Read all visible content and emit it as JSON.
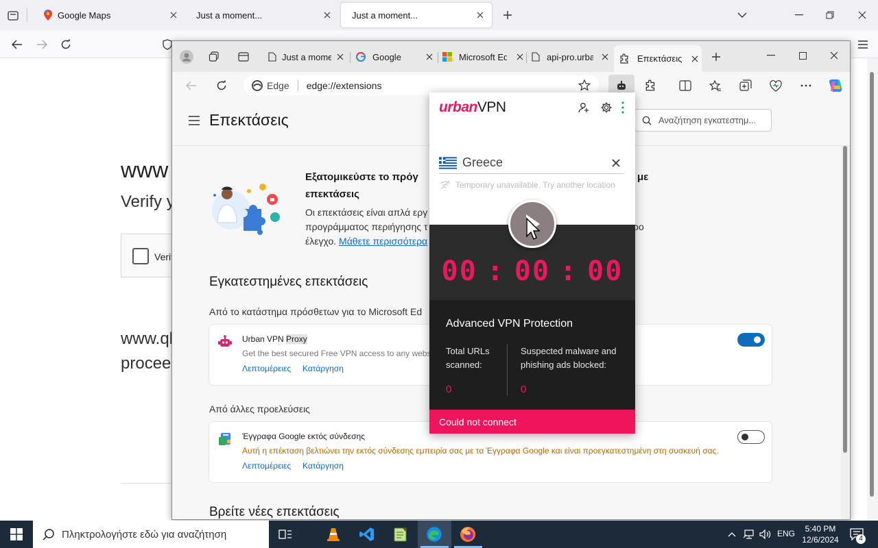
{
  "firefox": {
    "tabs": [
      {
        "label": "Google Maps"
      },
      {
        "label": "Just a moment..."
      },
      {
        "label": "Just a moment..."
      }
    ]
  },
  "page": {
    "heading_partial": "www",
    "verify_partial": "Verify y",
    "checkbox_label_partial": "Verif",
    "line1_partial": "www.ql",
    "line2_partial": "procee"
  },
  "edge": {
    "tabs": [
      {
        "label": "Just a mome"
      },
      {
        "label": "Google"
      },
      {
        "label": "Microsoft Ed"
      },
      {
        "label": "api-pro.urba"
      },
      {
        "label": "Επεκτάσεις"
      }
    ],
    "address": {
      "prefix": "Edge",
      "url": "edge://extensions"
    },
    "page_title": "Επεκτάσεις",
    "search_placeholder": "Αναζήτηση εγκατεστημ...",
    "promo": {
      "title_a": "Εξατομικεύστε το πρόγ",
      "title_b": "με",
      "title_c": "επεκτάσεις",
      "body_a": "Οι επεκτάσεις είναι απλά εργ",
      "body_b": "προγράμματος περιήγησης τ",
      "body_b2": "ρο",
      "body_c": "έλεγχο.",
      "learn_more": "Μάθετε περισσότερα"
    },
    "installed_heading": "Εγκατεστημένες επεκτάσεις",
    "store_label": "Από το κατάστημα πρόσθετων για το Microsoft Ed",
    "ext1": {
      "name": "Urban VPN",
      "name_highlight": "Proxy",
      "desc": "Get the best secured Free VPN access to any websit",
      "details": "Λεπτομέρειες",
      "remove": "Κατάργηση",
      "enabled": true
    },
    "other_label": "Από άλλες προελεύσεις",
    "ext2": {
      "name": "Έγγραφα Google εκτός σύνδεσης",
      "desc": "Αυτή η επέκταση βελτιώνει την εκτός σύνδεσης εμπειρία σας με τα Έγγραφα Google και είναι προεγκατεστημένη στη συσκευή σας.",
      "details": "Λεπτομέρειες",
      "remove": "Κατάργηση",
      "enabled": false
    },
    "more_heading": "Βρείτε νέες επεκτάσεις"
  },
  "popup": {
    "logo_a": "urban",
    "logo_b": "VPN",
    "location": "Greece",
    "unavailable": "Temporary unavailable. Try another location",
    "timer": {
      "h": "00",
      "m": "00",
      "s": "00",
      "sep": ":"
    },
    "protection_title": "Advanced VPN Protection",
    "stat1_label": "Total URLs scanned:",
    "stat1_value": "0",
    "stat2_label": "Suspected malware and phishing ads blocked:",
    "stat2_value": "0",
    "status": "Could not connect",
    "colors": {
      "brand": "#e8195c",
      "dark": "#1e1e1e"
    }
  },
  "taskbar": {
    "search_placeholder": "Πληκτρολογήστε εδώ για αναζήτηση",
    "lang": "ENG",
    "time": "5:40 PM",
    "date": "12/6/2024",
    "notif_count": "4"
  }
}
